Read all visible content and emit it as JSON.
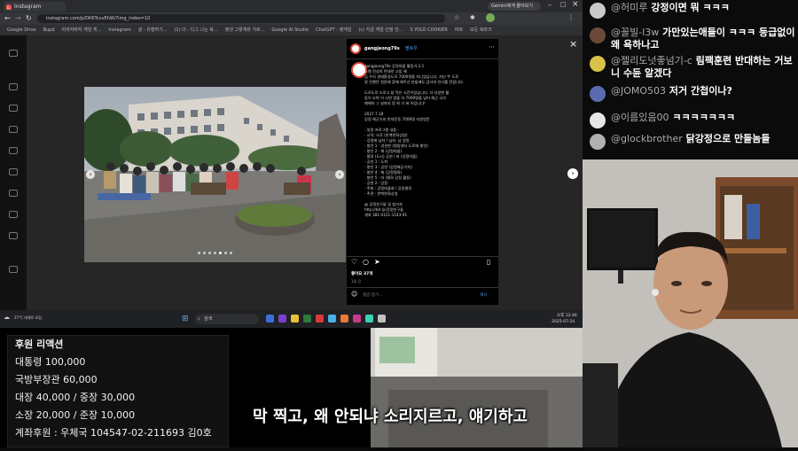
{
  "browser": {
    "tab_title": "Instagram",
    "tab_right": "Gemini에게 물어보기",
    "url": "instagram.com/p/DK6TcuvEhW/?img_index=10",
    "bookmarks": [
      "Google Drive",
      "Bupd",
      "아마자바자 게임 게...",
      "Instagram",
      "광 - 유행하기...",
      "(1) 더 - 디그 나는 복...",
      "렛넷 그렇게와 가르...",
      "Google AI Studio",
      "ChatGPT - 렛게임",
      "(c) 지금 게임 선정 안...",
      "S YOLO COOKIER",
      "마르",
      "모든 북마크"
    ]
  },
  "post": {
    "username": "gangjeong79s",
    "follow": "팔로우",
    "caption_lines": [
      "gangjeong79s 강정마을 활동가 2.1",
      "노벨 전성의 면대로 고립 해",
      "금 우리 생태환경도로 7000명을 지니었습니다. 지난 주 도로",
      "알 진행된 청원에 함께 해주신 분들께도 감사의 인사를 전합니다.",
      "",
      "도로도로 드로고 참 막은 시간이었습니다. 더 다양한 활",
      "동이 오며 이 사연 명을 아 7000명을 넘어 해군 국가",
      "폐해의 그 날까지 함 위 가 싸 어갑니다!",
      "",
      "2027.7.18",
      "강정 해군기지 반대운동 7000명 지원방문",
      "",
      "· 일정 프로그램 내용 -",
      "· 시작: 오후 (한백한화상영)",
      "· 강정에 남자 / 남자: 남 양망",
      "· 발언 1 : 경관판 (평양센터 도로에 발언)",
      "· 발언 2 : 해 (강정마을)",
      "· 평화 (도시) 공연 / 바 (강정마을)",
      "· 공연 1 : 도착",
      "· 발언 3 : 공연 (강정해군기지)",
      "· 발언 4 : 제 (강정평화)",
      "· 발언 5 : 마 (평화 강정 활동)",
      "· 공연 2 : 강정",
      "· 주최 : 강정마을회 / 강정평화",
      "· 주관 : 한백한화상영",
      "",
      "@ 강정친구들 및 참가자",
      "http://bit.ly/강정친구들",
      "계좌 381-0121-1143-91"
    ],
    "likes": "좋아요 37개",
    "time": "1일 전",
    "comment_placeholder": "댓글 달기...",
    "post_button": "게시"
  },
  "taskbar": {
    "weather": "27°C 대체로 흐림",
    "search": "검색",
    "time": "오후 12:46",
    "date": "2025-07-24"
  },
  "chat": [
    {
      "name": "@허미루",
      "text": "강정이면 뭐 ㅋㅋㅋ",
      "color": "#c9c9c9"
    },
    {
      "name": "@꼴빌-l3w",
      "text": "가만있는애들이 ㅋㅋㅋ 등급없이 왜 욕하나고",
      "color": "#6b4a3a"
    },
    {
      "name": "@젤리도넛좋넘기-c",
      "text": "림팩훈련 반대하는 거보니 수듄 알겠다",
      "color": "#d8c24a"
    },
    {
      "name": "@JOMO503",
      "text": "저거 간첩이나?",
      "color": "#5a6bb0"
    },
    {
      "name": "@이름있음00",
      "text": "ㅋㅋㅋㅋㅋㅋㅋ",
      "color": "#e5e5e5"
    },
    {
      "name": "@glockbrother",
      "text": "닭강정으로 만들놈들",
      "color": "#b0b0b0"
    }
  ],
  "donation": {
    "title": "후원 리액션",
    "lines": [
      "대통령 100,000",
      "국방부장관 60,000",
      "대장 40,000 / 중장 30,000",
      "소장 20,000 / 준장 10,000",
      "계좌후원 : 우체국 104547-02-211693 김0호"
    ]
  },
  "subtitle": "막 찍고, 왜 안되냐 소리지르고, 얘기하고"
}
